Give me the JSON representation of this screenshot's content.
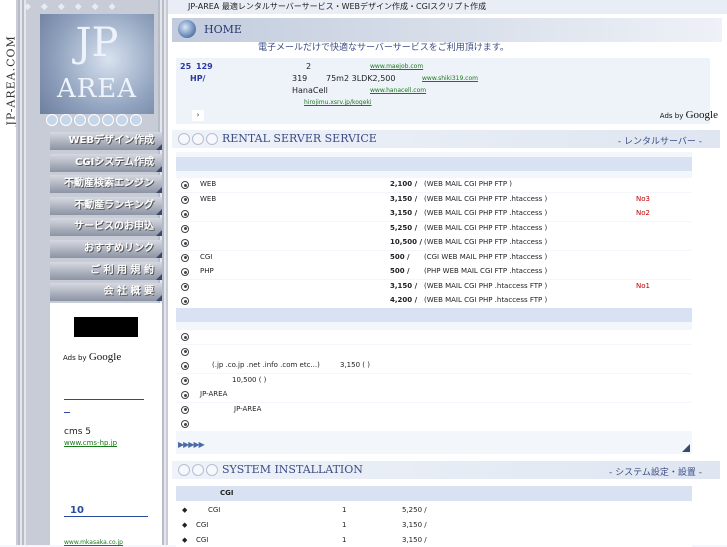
{
  "site": {
    "vertical_title": "JP-AREA.COM",
    "logo_top": "JP",
    "logo_bottom": "AREA"
  },
  "topbar": {
    "text": "JP-AREA 最適レンタルサーバーサービス・WEBデザイン作成・CGIスクリプト作成"
  },
  "menu": [
    "WEBデザイン作成",
    "CGIシステム作成",
    "不動産検索エンジン",
    "不動産ランキング",
    "サービスのお申込",
    "おすすめリンク",
    "ご 利 用 規 約",
    "会 社 概 要"
  ],
  "sidebar": {
    "ads_by": "Ads by",
    "google": "Google",
    "cms_text": "cms 5",
    "cms_url": "www.cms-hp.jp",
    "ten": "10",
    "bottom_url": "www.mkasaka.co.jp"
  },
  "home": {
    "title": "HOME",
    "subtitle": "電子メールだけで快適なサーバーサービスをご利用頂けます。",
    "line1": {
      "a": "25",
      "b": "129",
      "c": "2",
      "url": "www.maejob.com"
    },
    "line2": {
      "a": "HP/",
      "b": "319",
      "c": "75m2 3LDK2,500",
      "url": "www.shiki319.com"
    },
    "line3": {
      "a": "HanaCell",
      "url": "www.hanacell.com"
    },
    "line4": {
      "url": "hirojimu.xsrv.jp/kogeki"
    },
    "ads_by": "Ads by",
    "google": "Google"
  },
  "rental": {
    "title": "RENTAL SERVER SERVICE",
    "right": "- レンタルサーバー -",
    "rows": [
      {
        "name": "WEB",
        "price": "2,100 /",
        "spec": "(WEB MAIL   CGI PHP FTP  )",
        "note": ""
      },
      {
        "name": "WEB",
        "price": "3,150 /",
        "spec": "(WEB MAIL CGI PHP FTP .htaccess  )",
        "note": "No3"
      },
      {
        "name": "",
        "price": "3,150 /",
        "spec": "(WEB MAIL CGI PHP FTP .htaccess  )",
        "note": "No2"
      },
      {
        "name": "",
        "price": "5,250 /",
        "spec": "(WEB MAIL CGI PHP FTP .htaccess  )",
        "note": ""
      },
      {
        "name": "",
        "price": "10,500 /",
        "spec": "(WEB MAIL CGI PHP FTP .htaccess  )",
        "note": ""
      },
      {
        "name": "CGI",
        "price": "500 /",
        "spec": "(CGI   WEB MAIL PHP FTP .htaccess  )",
        "note": ""
      },
      {
        "name": "PHP",
        "price": "500 /",
        "spec": "(PHP   WEB MAIL CGI FTP .htaccess  )",
        "note": ""
      },
      {
        "name": "",
        "price": "3,150 /",
        "spec": "(WEB MAIL CGI PHP .htaccess   FTP  )",
        "note": "No1"
      },
      {
        "name": "",
        "price": "4,200 /",
        "spec": "(WEB MAIL CGI PHP .htaccess   FTP  )",
        "note": ""
      }
    ],
    "domain_rows": [
      {
        "a": "",
        "b": ""
      },
      {
        "a": "",
        "b": ""
      },
      {
        "a": "(.jp .co.jp .net .info .com etc...)",
        "b": "3,150 (  )"
      },
      {
        "a": "10,500 (  )",
        "b": ""
      },
      {
        "a": "JP-AREA",
        "b": ""
      },
      {
        "a": "JP-AREA",
        "b": ""
      },
      {
        "a": "",
        "b": ""
      }
    ]
  },
  "system": {
    "title": "SYSTEM INSTALLATION",
    "right": "- システム設定・設置 -",
    "header": "CGI",
    "rows": [
      {
        "name": "CGI",
        "qty": "1",
        "price": "5,250 /"
      },
      {
        "name": "CGI",
        "qty": "1",
        "price": "3,150 /"
      },
      {
        "name": "CGI",
        "qty": "1",
        "price": "3,150 /"
      }
    ]
  }
}
